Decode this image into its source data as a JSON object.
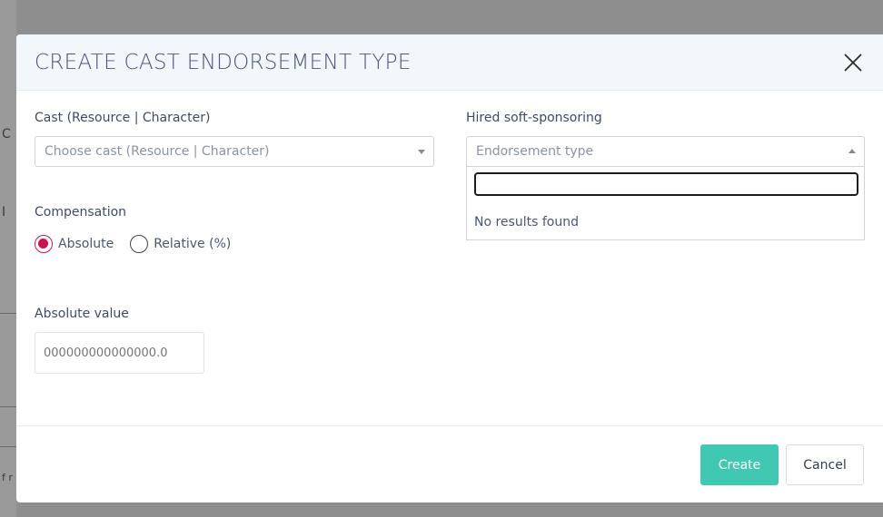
{
  "backdrop": {
    "glyphs": [
      "C",
      "I",
      "f r"
    ]
  },
  "modal": {
    "title": "CREATE CAST ENDORSEMENT TYPE",
    "close_icon": "close-icon"
  },
  "cast": {
    "label": "Cast (Resource | Character)",
    "placeholder": "Choose cast (Resource | Character)"
  },
  "sponsoring": {
    "label": "Hired soft-sponsoring",
    "placeholder": "Endorsement type",
    "search_value": "",
    "no_results": "No results found"
  },
  "compensation": {
    "label": "Compensation",
    "options": [
      {
        "label": "Absolute",
        "checked": true
      },
      {
        "label": "Relative (%)",
        "checked": false
      }
    ]
  },
  "absolute_value": {
    "label": "Absolute value",
    "placeholder": "000000000000000.0"
  },
  "footer": {
    "create_label": "Create",
    "cancel_label": "Cancel"
  },
  "colors": {
    "accent": "#40c8b2",
    "radio_checked": "#c8134e",
    "title": "#4a5578"
  }
}
